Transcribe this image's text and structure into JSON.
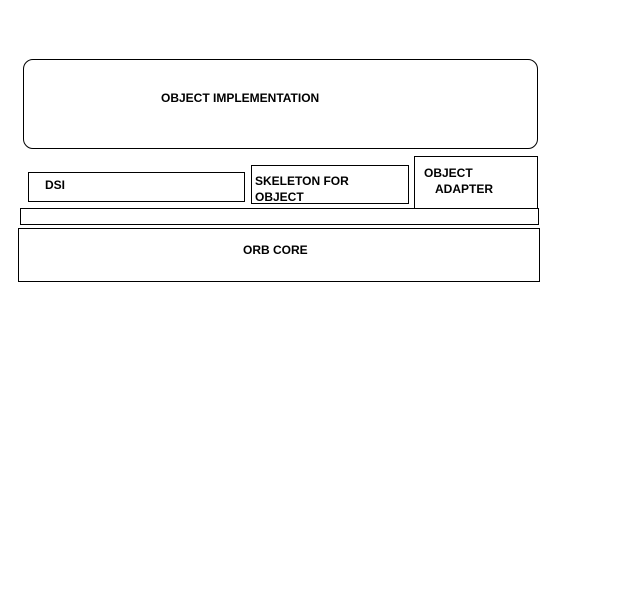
{
  "diagram": {
    "object_implementation": "OBJECT IMPLEMENTATION",
    "dsi": "DSI",
    "skeleton": {
      "line1": "SKELETON FOR",
      "line2": "OBJECT"
    },
    "object_adapter": {
      "line1": "OBJECT",
      "line2": "ADAPTER"
    },
    "orb_core": "ORB CORE"
  }
}
